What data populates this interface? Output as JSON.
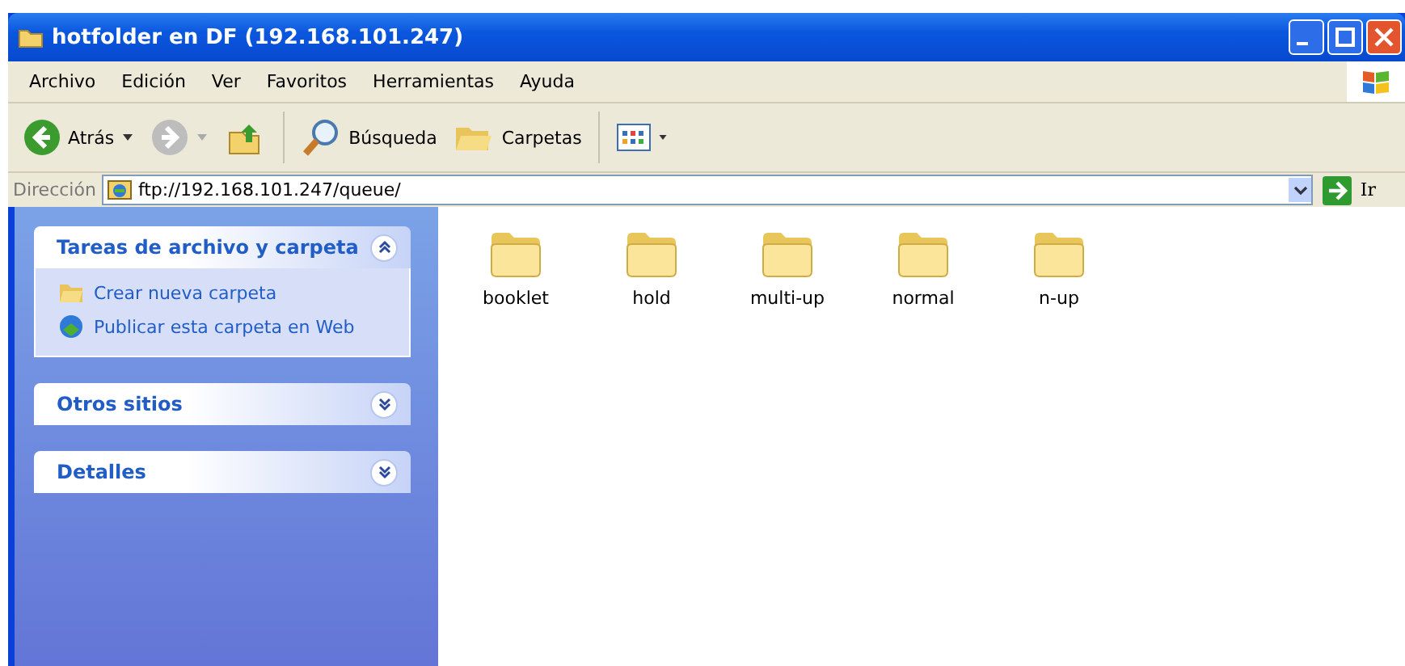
{
  "window": {
    "title": "hotfolder en DF (192.168.101.247)"
  },
  "menu": [
    "Archivo",
    "Edición",
    "Ver",
    "Favoritos",
    "Herramientas",
    "Ayuda"
  ],
  "toolbar": {
    "back": "Atrás",
    "search": "Búsqueda",
    "folders": "Carpetas"
  },
  "address": {
    "label": "Dirección",
    "value": "ftp://192.168.101.247/queue/",
    "go": "Ir"
  },
  "panels": [
    {
      "title": "Tareas de archivo y carpeta",
      "expanded": true,
      "items": [
        {
          "label": "Crear nueva carpeta",
          "kind": "folder"
        },
        {
          "label": "Publicar esta carpeta en Web",
          "kind": "web"
        }
      ]
    },
    {
      "title": "Otros sitios",
      "expanded": false
    },
    {
      "title": "Detalles",
      "expanded": false
    }
  ],
  "folders": [
    "booklet",
    "hold",
    "multi-up",
    "normal",
    "n-up"
  ]
}
